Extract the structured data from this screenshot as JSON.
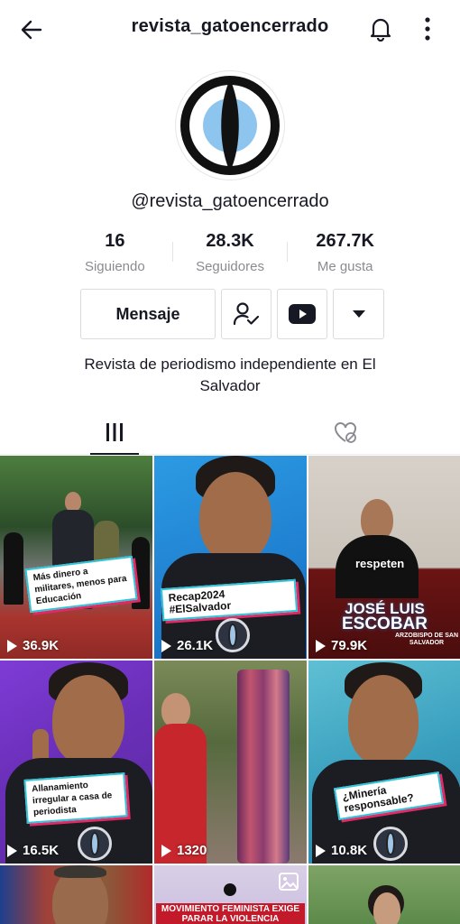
{
  "header": {
    "title": "revista_gatoencerrado",
    "back_icon": "arrow-left-icon",
    "bell_icon": "bell-icon",
    "more_icon": "more-vertical-icon"
  },
  "profile": {
    "handle": "@revista_gatoencerrado",
    "stats": [
      {
        "value": "16",
        "label": "Siguiendo"
      },
      {
        "value": "28.3K",
        "label": "Seguidores"
      },
      {
        "value": "267.7K",
        "label": "Me gusta"
      }
    ],
    "actions": {
      "message_label": "Mensaje",
      "user_check_icon": "user-check-icon",
      "youtube_icon": "youtube-icon",
      "dropdown_icon": "caret-down-icon"
    },
    "bio": "Revista de periodismo independiente en El Salvador"
  },
  "tabs": [
    {
      "icon": "grid-icon",
      "active": true
    },
    {
      "icon": "liked-hidden-icon",
      "active": false
    }
  ],
  "videos": [
    {
      "views": "36.9K",
      "caption": "Más dinero a militares, menos para Educación"
    },
    {
      "views": "26.1K",
      "caption": "Recap2024 #ElSalvador"
    },
    {
      "views": "79.9K",
      "caption": "respeten",
      "title_line1": "JOSÉ LUIS",
      "title_line2": "ESCOBAR",
      "subtitle": "ARZOBISPO DE SAN SALVADOR"
    },
    {
      "views": "16.5K",
      "caption": "Allanamiento irregular a casa de periodista"
    },
    {
      "views": "1320",
      "caption": ""
    },
    {
      "views": "10.8K",
      "caption": "¿Minería responsable?"
    },
    {
      "views": "",
      "caption": ""
    },
    {
      "views": "",
      "caption": "MOVIMIENTO FEMINISTA EXIGE PARAR LA VIOLENCIA"
    },
    {
      "views": "",
      "caption": ""
    }
  ],
  "colors": {
    "text": "#161823",
    "muted": "#8a8b91",
    "tag_border_cyan": "#31c4d8",
    "tag_shadow_pink": "#e02a66",
    "banner_red": "#b5121b"
  }
}
